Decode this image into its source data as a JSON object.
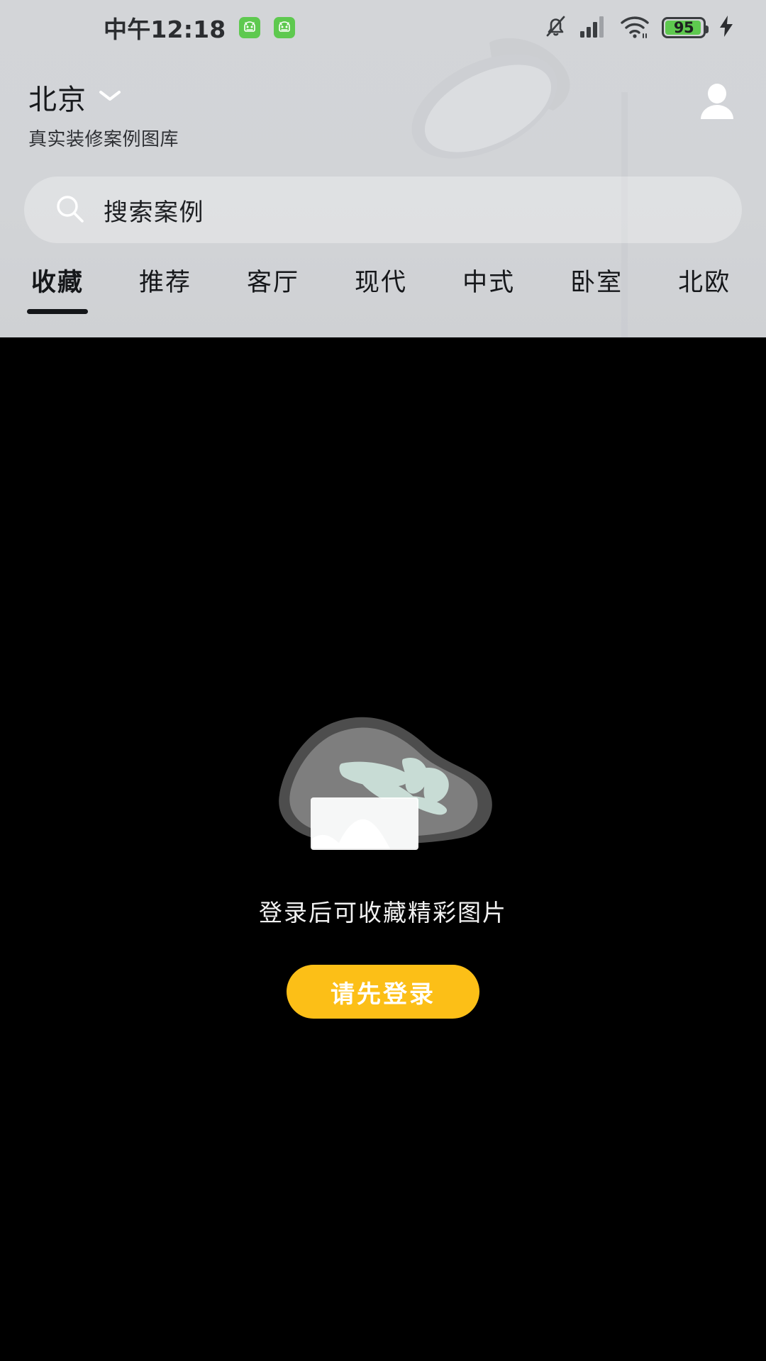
{
  "statusbar": {
    "time": "中午12:18",
    "app_icons": [
      "app-badge-icon",
      "app-badge-icon"
    ],
    "mute_icon": "bell-muted-icon",
    "signal_icon": "cellular-signal-icon",
    "wifi_icon": "wifi-icon",
    "battery_level": "95",
    "charging_icon": "charging-bolt-icon",
    "battery_color": "#5ec94f"
  },
  "header": {
    "city": "北京",
    "city_chevron_icon": "chevron-down-icon",
    "subtitle": "真实装修案例图库",
    "avatar_icon": "user-avatar-icon",
    "background_color": "#d3d5d8",
    "watermark": "lamp-watermark"
  },
  "search": {
    "icon": "search-icon",
    "placeholder": "搜索案例",
    "value": ""
  },
  "tabs": {
    "active_index": 0,
    "items": [
      {
        "label": "收藏"
      },
      {
        "label": "推荐"
      },
      {
        "label": "客厅"
      },
      {
        "label": "现代"
      },
      {
        "label": "中式"
      },
      {
        "label": "卧室"
      },
      {
        "label": "北欧"
      }
    ]
  },
  "empty_state": {
    "illustration": "empty-gallery-illustration",
    "message": "登录后可收藏精彩图片",
    "button_label": "请先登录",
    "button_color": "#fcbf17",
    "background_color": "#000000"
  }
}
